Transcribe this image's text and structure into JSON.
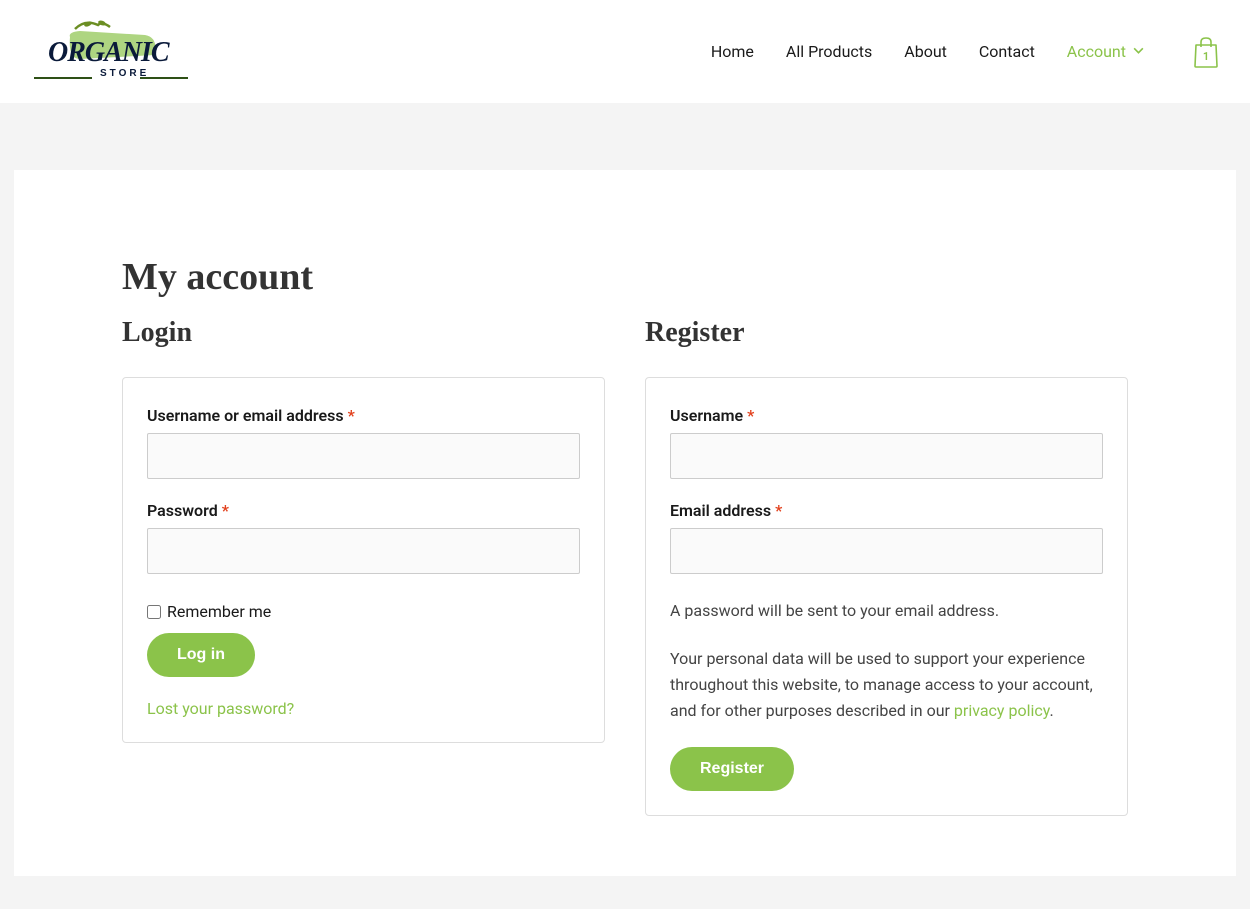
{
  "logo": {
    "text_top": "ORGANIC",
    "text_bottom": "STORE"
  },
  "nav": {
    "home": "Home",
    "all_products": "All Products",
    "about": "About",
    "contact": "Contact",
    "account": "Account"
  },
  "cart": {
    "count": "1"
  },
  "page": {
    "title": "My account"
  },
  "login": {
    "heading": "Login",
    "username_label": "Username or email address ",
    "password_label": "Password ",
    "remember_label": "Remember me",
    "submit": "Log in",
    "lost_password": "Lost your password?"
  },
  "register": {
    "heading": "Register",
    "username_label": "Username ",
    "email_label": "Email address ",
    "info": "A password will be sent to your email address.",
    "privacy_pre": "Your personal data will be used to support your experience throughout this website, to manage access to your account, and for other purposes described in our ",
    "privacy_link": "privacy policy",
    "privacy_post": ".",
    "submit": "Register"
  },
  "required_mark": "*"
}
